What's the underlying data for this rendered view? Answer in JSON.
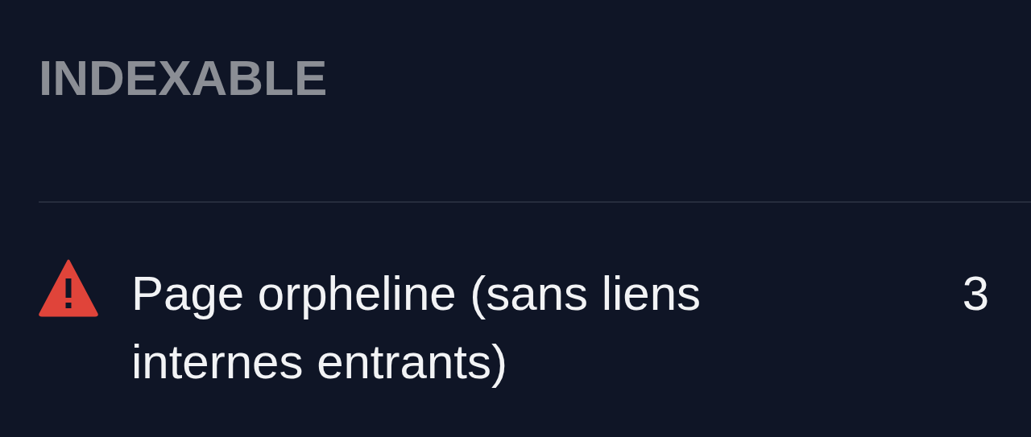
{
  "section": {
    "title": "INDEXABLE"
  },
  "issues": [
    {
      "color": "#e0443a",
      "label": "Page orpheline (sans liens internes entrants)",
      "count": "3"
    }
  ]
}
